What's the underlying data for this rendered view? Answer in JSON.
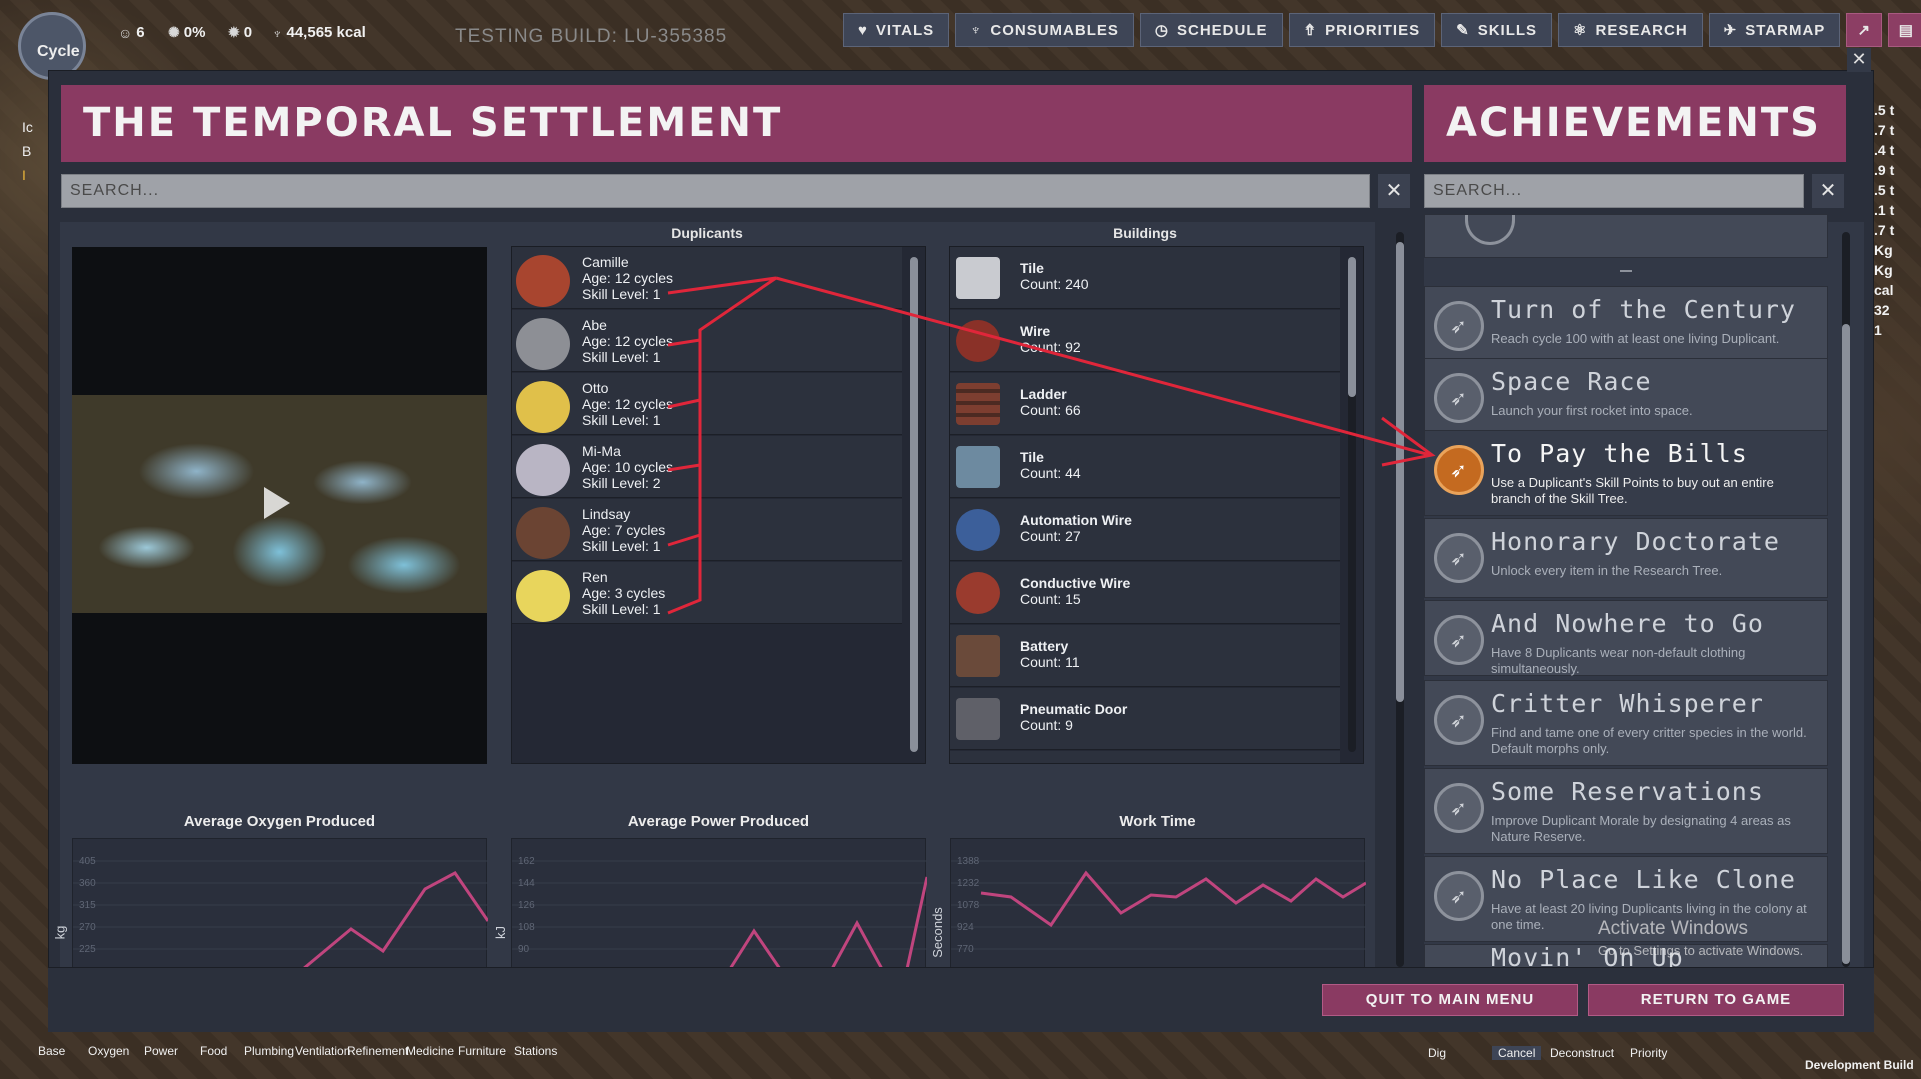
{
  "hud": {
    "cycle": "Cycle",
    "duplicants": "6",
    "stress": "0%",
    "sick": "0",
    "calories": "44,565 kcal",
    "testing_build": "TESTING BUILD: LU-355385"
  },
  "topnav": [
    {
      "label": "VITALS",
      "icon": "heart-icon"
    },
    {
      "label": "CONSUMABLES",
      "icon": "fork-knife-icon"
    },
    {
      "label": "SCHEDULE",
      "icon": "clock-icon"
    },
    {
      "label": "PRIORITIES",
      "icon": "priority-icon"
    },
    {
      "label": "SKILLS",
      "icon": "wrench-icon"
    },
    {
      "label": "RESEARCH",
      "icon": "research-icon"
    },
    {
      "label": "STARMAP",
      "icon": "rocket-icon"
    }
  ],
  "colony": {
    "title": "THE TEMPORAL SETTLEMENT",
    "search_placeholder": "SEARCH...",
    "duplicants_title": "Duplicants",
    "buildings_title": "Buildings",
    "duplicants": [
      {
        "name": "Camille",
        "age": "Age: 12 cycles",
        "skill": "Skill Level: 1",
        "color": "#a8452f"
      },
      {
        "name": "Abe",
        "age": "Age: 12 cycles",
        "skill": "Skill Level: 1",
        "color": "#8d8f95"
      },
      {
        "name": "Otto",
        "age": "Age: 12 cycles",
        "skill": "Skill Level: 1",
        "color": "#e0c04a"
      },
      {
        "name": "Mi-Ma",
        "age": "Age: 10 cycles",
        "skill": "Skill Level: 2",
        "color": "#b9b5c4"
      },
      {
        "name": "Lindsay",
        "age": "Age: 7 cycles",
        "skill": "Skill Level: 1",
        "color": "#6b4433"
      },
      {
        "name": "Ren",
        "age": "Age: 3 cycles",
        "skill": "Skill Level: 1",
        "color": "#e8d55c"
      }
    ],
    "buildings": [
      {
        "name": "Tile",
        "count": "Count: 240",
        "color": "#c9cbd0"
      },
      {
        "name": "Wire",
        "count": "Count: 92",
        "color": "#8a3128"
      },
      {
        "name": "Ladder",
        "count": "Count: 66",
        "color": "#7d3e30"
      },
      {
        "name": "Tile",
        "count": "Count: 44",
        "color": "#6d8aa0"
      },
      {
        "name": "Automation Wire",
        "count": "Count: 27",
        "color": "#3c5f9a"
      },
      {
        "name": "Conductive Wire",
        "count": "Count: 15",
        "color": "#9a3b2e"
      },
      {
        "name": "Battery",
        "count": "Count: 11",
        "color": "#6a4a3a"
      },
      {
        "name": "Pneumatic Door",
        "count": "Count: 9",
        "color": "#5f6068"
      }
    ]
  },
  "charts": [
    {
      "title": "Average Oxygen Produced",
      "ylabel": "kg",
      "ticks": [
        "405",
        "360",
        "315",
        "270",
        "225"
      ]
    },
    {
      "title": "Average Power Produced",
      "ylabel": "kJ",
      "ticks": [
        "162",
        "144",
        "126",
        "108",
        "90"
      ]
    },
    {
      "title": "Work Time",
      "ylabel": "Seconds",
      "ticks": [
        "1388",
        "1232",
        "1078",
        "924",
        "770"
      ]
    }
  ],
  "achievements": {
    "title": "ACHIEVEMENTS",
    "search_placeholder": "SEARCH...",
    "items": [
      {
        "title": "Turn of the Century",
        "desc": "Reach cycle 100 with at least one living Duplicant."
      },
      {
        "title": "Space Race",
        "desc": "Launch your first rocket into space."
      },
      {
        "title": "To Pay the Bills",
        "desc": "Use a Duplicant's Skill Points to buy out an entire branch of the Skill Tree."
      },
      {
        "title": "Honorary Doctorate",
        "desc": "Unlock every item in the Research Tree."
      },
      {
        "title": "And Nowhere to Go",
        "desc": "Have 8 Duplicants wear non-default clothing simultaneously."
      },
      {
        "title": "Critter Whisperer",
        "desc": "Find and tame one of every critter species in the world. Default morphs only."
      },
      {
        "title": "Some Reservations",
        "desc": "Improve Duplicant Morale by designating 4 areas as Nature Reserve."
      },
      {
        "title": "No Place Like Clone",
        "desc": "Have at least 20 living Duplicants living in the colony at one time."
      },
      {
        "title": "Movin' On Up",
        "desc": ""
      }
    ]
  },
  "buttons": {
    "quit": "QUIT TO MAIN MENU",
    "return": "RETURN TO GAME"
  },
  "watermark": {
    "line1": "Activate Windows",
    "line2": "Go to Settings to activate Windows."
  },
  "bottom_toolbar": {
    "left": [
      "Base",
      "Oxygen",
      "Power",
      "Food",
      "Plumbing",
      "Ventilation",
      "Refinement",
      "Medicine",
      "Furniture",
      "Stations"
    ],
    "right": [
      "Dig",
      "Cancel",
      "Deconstruct",
      "Priority"
    ],
    "dev": "Development Build"
  },
  "right_strip": [
    ".5 t",
    ".7 t",
    ".4 t",
    ".9 t",
    ".5 t",
    ".1 t",
    ".7 t",
    "Kg",
    "Kg",
    "cal",
    "32",
    "1"
  ],
  "left_strip": [
    "Ic",
    "B",
    "I"
  ]
}
